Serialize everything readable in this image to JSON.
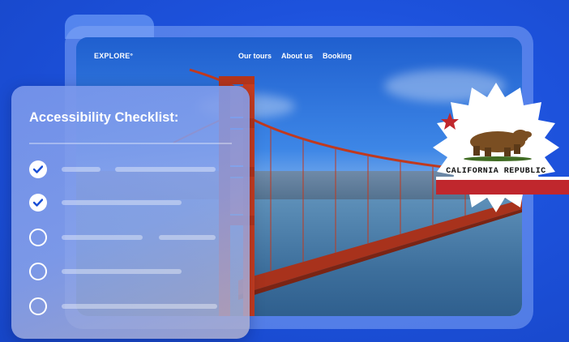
{
  "site": {
    "logo": "EXPLORE°",
    "nav": [
      "Our tours",
      "About us",
      "Booking"
    ]
  },
  "checklist": {
    "title": "Accessibility Checklist:",
    "items": [
      {
        "checked": true
      },
      {
        "checked": true
      },
      {
        "checked": false
      },
      {
        "checked": false
      },
      {
        "checked": false
      }
    ]
  },
  "seal": {
    "text": "CALIFORNIA REPUBLIC"
  },
  "colors": {
    "background": "#1a4fd6",
    "bridge": "#c0391e",
    "flag_red": "#c0272d",
    "white": "#ffffff"
  }
}
